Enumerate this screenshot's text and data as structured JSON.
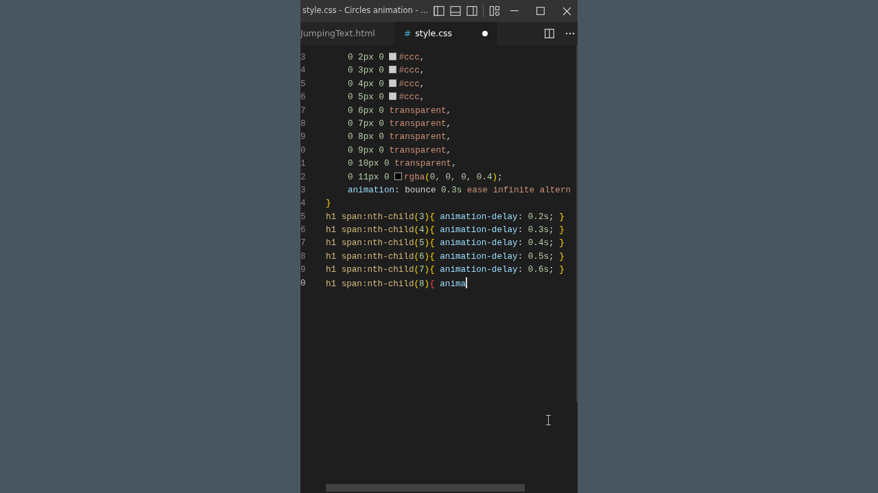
{
  "window": {
    "title": "style.css - Circles animation - ..."
  },
  "tabs": [
    {
      "label": "JumpingText.html",
      "selected": false,
      "modified": false
    },
    {
      "label": "style.css",
      "selected": true,
      "modified": true,
      "icon": "#"
    }
  ],
  "editor": {
    "lines": [
      {
        "number": "3",
        "indented": true,
        "tokens": [
          {
            "kind": "num",
            "text": "0 2px 0 "
          },
          {
            "kind": "swatch",
            "color": "#cccccc"
          },
          {
            "kind": "value",
            "text": "#ccc"
          },
          {
            "kind": "punct",
            "text": ","
          }
        ]
      },
      {
        "number": "4",
        "indented": true,
        "tokens": [
          {
            "kind": "num",
            "text": "0 3px 0 "
          },
          {
            "kind": "swatch",
            "color": "#cccccc"
          },
          {
            "kind": "value",
            "text": "#ccc"
          },
          {
            "kind": "punct",
            "text": ","
          }
        ]
      },
      {
        "number": "5",
        "indented": true,
        "tokens": [
          {
            "kind": "num",
            "text": "0 4px 0 "
          },
          {
            "kind": "swatch",
            "color": "#cccccc"
          },
          {
            "kind": "value",
            "text": "#ccc"
          },
          {
            "kind": "punct",
            "text": ","
          }
        ]
      },
      {
        "number": "6",
        "indented": true,
        "tokens": [
          {
            "kind": "num",
            "text": "0 5px 0 "
          },
          {
            "kind": "swatch",
            "color": "#cccccc"
          },
          {
            "kind": "value",
            "text": "#ccc"
          },
          {
            "kind": "punct",
            "text": ","
          }
        ]
      },
      {
        "number": "7",
        "indented": true,
        "tokens": [
          {
            "kind": "num",
            "text": "0 6px 0 "
          },
          {
            "kind": "value",
            "text": "transparent"
          },
          {
            "kind": "punct",
            "text": ","
          }
        ]
      },
      {
        "number": "8",
        "indented": true,
        "tokens": [
          {
            "kind": "num",
            "text": "0 7px 0 "
          },
          {
            "kind": "value",
            "text": "transparent"
          },
          {
            "kind": "punct",
            "text": ","
          }
        ]
      },
      {
        "number": "9",
        "indented": true,
        "tokens": [
          {
            "kind": "num",
            "text": "0 8px 0 "
          },
          {
            "kind": "value",
            "text": "transparent"
          },
          {
            "kind": "punct",
            "text": ","
          }
        ]
      },
      {
        "number": "0",
        "indented": true,
        "tokens": [
          {
            "kind": "num",
            "text": "0 9px 0 "
          },
          {
            "kind": "value",
            "text": "transparent"
          },
          {
            "kind": "punct",
            "text": ","
          }
        ]
      },
      {
        "number": "1",
        "indented": true,
        "tokens": [
          {
            "kind": "num",
            "text": "0 10px 0 "
          },
          {
            "kind": "value",
            "text": "transparent"
          },
          {
            "kind": "punct",
            "text": ","
          }
        ]
      },
      {
        "number": "2",
        "indented": true,
        "tokens": [
          {
            "kind": "num",
            "text": "0 11px 0 "
          },
          {
            "kind": "swatch",
            "color": "#000000"
          },
          {
            "kind": "value",
            "text": "rgba"
          },
          {
            "kind": "bracket",
            "text": "("
          },
          {
            "kind": "num",
            "text": "0, 0, 0, 0.4"
          },
          {
            "kind": "bracket",
            "text": ")"
          },
          {
            "kind": "punct",
            "text": ";"
          }
        ]
      },
      {
        "number": "3",
        "indented": true,
        "tokens": [
          {
            "kind": "prop",
            "text": "animation"
          },
          {
            "kind": "punct",
            "text": ": "
          },
          {
            "kind": "plain",
            "text": "bounce "
          },
          {
            "kind": "num",
            "text": "0.3s "
          },
          {
            "kind": "value",
            "text": "ease infinite altern"
          }
        ]
      },
      {
        "number": "4",
        "tokens": [
          {
            "kind": "bracket",
            "text": "}"
          }
        ]
      },
      {
        "number": "5",
        "tokens": [
          {
            "kind": "selector",
            "text": "h1 span:nth-child"
          },
          {
            "kind": "bracket",
            "text": "("
          },
          {
            "kind": "num",
            "text": "3"
          },
          {
            "kind": "bracket",
            "text": ")"
          },
          {
            "kind": "bracket",
            "text": "{ "
          },
          {
            "kind": "prop",
            "text": "animation-delay"
          },
          {
            "kind": "punct",
            "text": ": "
          },
          {
            "kind": "num",
            "text": "0.2s"
          },
          {
            "kind": "punct",
            "text": "; "
          },
          {
            "kind": "bracket",
            "text": "}"
          }
        ]
      },
      {
        "number": "6",
        "tokens": [
          {
            "kind": "selector",
            "text": "h1 span:nth-child"
          },
          {
            "kind": "bracket",
            "text": "("
          },
          {
            "kind": "num",
            "text": "4"
          },
          {
            "kind": "bracket",
            "text": ")"
          },
          {
            "kind": "bracket",
            "text": "{ "
          },
          {
            "kind": "prop",
            "text": "animation-delay"
          },
          {
            "kind": "punct",
            "text": ": "
          },
          {
            "kind": "num",
            "text": "0.3s"
          },
          {
            "kind": "punct",
            "text": "; "
          },
          {
            "kind": "bracket",
            "text": "}"
          }
        ]
      },
      {
        "number": "7",
        "tokens": [
          {
            "kind": "selector",
            "text": "h1 span:nth-child"
          },
          {
            "kind": "bracket",
            "text": "("
          },
          {
            "kind": "num",
            "text": "5"
          },
          {
            "kind": "bracket",
            "text": ")"
          },
          {
            "kind": "bracket",
            "text": "{ "
          },
          {
            "kind": "prop",
            "text": "animation-delay"
          },
          {
            "kind": "punct",
            "text": ": "
          },
          {
            "kind": "num",
            "text": "0.4s"
          },
          {
            "kind": "punct",
            "text": "; "
          },
          {
            "kind": "bracket",
            "text": "}"
          }
        ]
      },
      {
        "number": "8",
        "tokens": [
          {
            "kind": "selector",
            "text": "h1 span:nth-child"
          },
          {
            "kind": "bracket",
            "text": "("
          },
          {
            "kind": "num",
            "text": "6"
          },
          {
            "kind": "bracket",
            "text": ")"
          },
          {
            "kind": "bracket",
            "text": "{ "
          },
          {
            "kind": "prop",
            "text": "animation-delay"
          },
          {
            "kind": "punct",
            "text": ": "
          },
          {
            "kind": "num",
            "text": "0.5s"
          },
          {
            "kind": "punct",
            "text": "; "
          },
          {
            "kind": "bracket",
            "text": "}"
          }
        ]
      },
      {
        "number": "9",
        "tokens": [
          {
            "kind": "selector",
            "text": "h1 span:nth-child"
          },
          {
            "kind": "bracket",
            "text": "("
          },
          {
            "kind": "num",
            "text": "7"
          },
          {
            "kind": "bracket",
            "text": ")"
          },
          {
            "kind": "bracket",
            "text": "{ "
          },
          {
            "kind": "prop",
            "text": "animation-delay"
          },
          {
            "kind": "punct",
            "text": ": "
          },
          {
            "kind": "num",
            "text": "0.6s"
          },
          {
            "kind": "punct",
            "text": "; "
          },
          {
            "kind": "bracket",
            "text": "}"
          }
        ]
      },
      {
        "number": "0",
        "current": true,
        "tokens": [
          {
            "kind": "selector",
            "text": "h1 span:nth-child"
          },
          {
            "kind": "bracket",
            "text": "("
          },
          {
            "kind": "num",
            "text": "8"
          },
          {
            "kind": "bracket",
            "text": ")"
          },
          {
            "kind": "error",
            "text": "{ "
          },
          {
            "kind": "prop",
            "text": "anima"
          },
          {
            "kind": "cursor"
          }
        ]
      }
    ]
  }
}
